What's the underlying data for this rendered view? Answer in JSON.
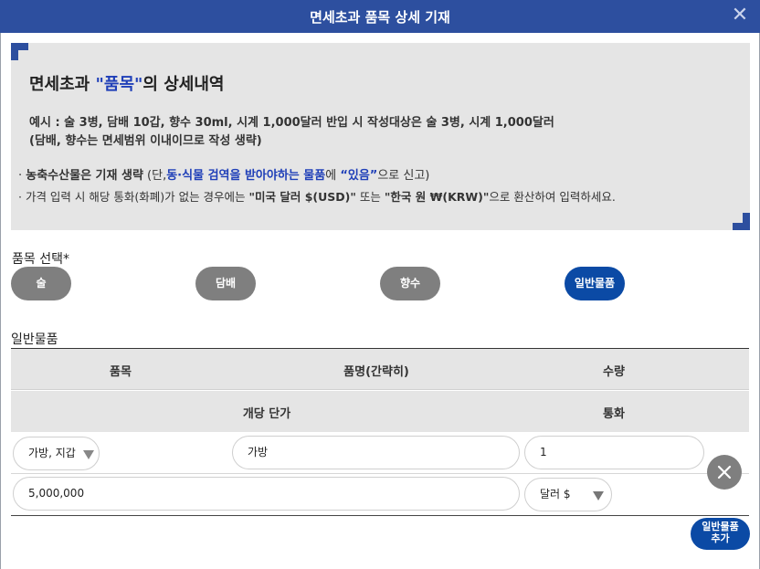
{
  "dialog": {
    "title": "면세초과 품목 상세 기재",
    "close_icon": "close-icon"
  },
  "notice": {
    "heading_pre": "면세초과 ",
    "heading_q": "\"품목\"",
    "heading_post": "의 상세내역",
    "example_line1": "예시 : 술 3병, 담배 10갑, 향수 30ml, 시계 1,000달러 반입 시 작성대상은 술 3병, 시계 1,000달러",
    "example_line2": "(담배, 향수는 면세범위 이내이므로 작성 생략)",
    "bullet1_a": "· ",
    "bullet1_b": "농축수산물은 기재 생략",
    "bullet1_c": " (단,",
    "bullet1_d": "동·식물 검역을 받아야하는 물품",
    "bullet1_e": "에 ",
    "bullet1_f": "“있음”",
    "bullet1_g": "으로 신고)",
    "bullet2_a": "· 가격 입력 시 해당 통화(화폐)가 없는 경우에는 ",
    "bullet2_b": "\"미국 달러 $(USD)\"",
    "bullet2_c": " 또는 ",
    "bullet2_d": "\"한국 원 ₩(KRW)\"",
    "bullet2_e": "으로 환산하여 입력하세요."
  },
  "category": {
    "label": "품목 선택*",
    "options": [
      "술",
      "담배",
      "향수",
      "일반물품"
    ],
    "selected": "일반물품"
  },
  "table": {
    "section_label": "일반물품",
    "headers_row1": [
      "품목",
      "품명(간략히)",
      "수량"
    ],
    "headers_row2": [
      "개당 단가",
      "통화"
    ],
    "rows": [
      {
        "item_type": "가방, 지갑",
        "item_name": "가방",
        "quantity": "1",
        "unit_price": "5,000,000",
        "currency": "달러 $"
      }
    ]
  },
  "actions": {
    "add_label_line1": "일반물품",
    "add_label_line2": "추가",
    "delete_icon": "close-circle-icon"
  },
  "colors": {
    "primary": "#2d4f9f",
    "button_blue": "#0b4aa5",
    "pill_gray": "#7f7f7f",
    "notice_bg": "#e5e5e5"
  }
}
